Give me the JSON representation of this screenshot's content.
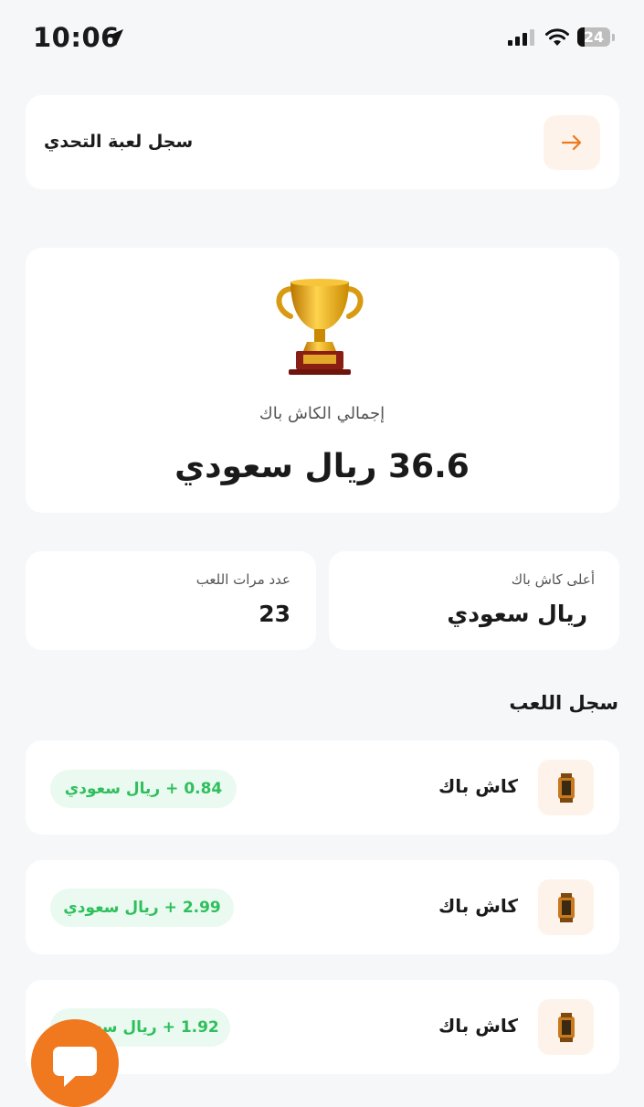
{
  "status_bar": {
    "time": "10:06",
    "battery": "24"
  },
  "header": {
    "title": "سجل لعبة التحدي",
    "back_icon": "arrow-right-icon"
  },
  "summary": {
    "label": "إجمالي الكاش باك",
    "value": "36.6 ريال سعودي",
    "icon": "trophy-icon"
  },
  "stats": {
    "highest": {
      "label": "أعلى كاش باك",
      "value": "ريال سعودي"
    },
    "plays": {
      "label": "عدد مرات اللعب",
      "value": "23"
    }
  },
  "history": {
    "title": "سجل اللعب",
    "items": [
      {
        "title": "كاش باك",
        "amount": "0.84 + ريال سعودي"
      },
      {
        "title": "كاش باك",
        "amount": "2.99 + ريال سعودي"
      },
      {
        "title": "كاش باك",
        "amount": "1.92 + ريال سعودي"
      }
    ]
  },
  "colors": {
    "accent": "#f0781e",
    "success": "#2fbf5c",
    "background": "#f6f7f9"
  }
}
